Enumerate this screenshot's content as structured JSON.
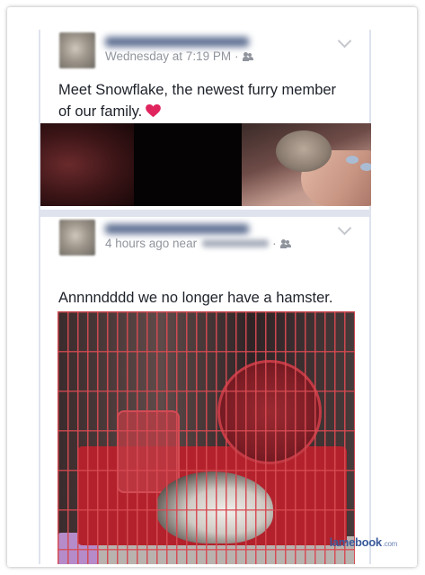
{
  "posts": [
    {
      "meta": "Wednesday at 7:19 PM",
      "separator": "·",
      "message_line1": "Meet Snowflake, the newest furry member",
      "message_line2": "of our family."
    },
    {
      "meta": "4 hours ago near",
      "separator": "·",
      "message": "Annnndddd we no longer have a hamster."
    }
  ],
  "watermark": {
    "brand": "lamebook",
    "tld": ".com"
  },
  "colors": {
    "feed_bg": "#dfe3ee",
    "text": "#1d2129",
    "meta": "#90949c",
    "heart": "#e0245e"
  },
  "icons": [
    "audience-friends-icon",
    "chevron-down-icon",
    "heart-emoji-icon"
  ]
}
